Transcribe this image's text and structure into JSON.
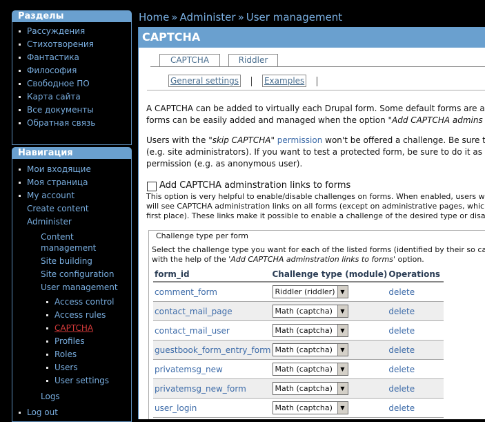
{
  "sidebar_sections": {
    "title": "Разделы",
    "items": [
      "Рассуждения",
      "Стихотворения",
      "Фантастика",
      "Философия",
      "Свободное ПО",
      "Карта сайта",
      "Все документы",
      "Обратная связь"
    ]
  },
  "sidebar_navigation": {
    "title": "Навигация",
    "items": [
      "Мои входящие",
      "Моя страница",
      "My account",
      "Create content",
      "Administer"
    ],
    "administer_items": [
      "Content management",
      "Site building",
      "Site configuration",
      "User management"
    ],
    "user_management_items": [
      "Access control",
      "Access rules",
      "CAPTCHA",
      "Profiles",
      "Roles",
      "Users",
      "User settings"
    ],
    "logs": "Logs",
    "logout": "Log out"
  },
  "breadcrumb": [
    "Home",
    "Administer",
    "User management"
  ],
  "page_title": "CAPTCHA",
  "tabs": [
    "CAPTCHA",
    "Riddler"
  ],
  "subtabs": [
    "General settings",
    "Examples"
  ],
  "intro": {
    "line1": "A CAPTCHA can be added to virtually each Drupal form. Some default forms are a",
    "line2_pre": "forms can be easily added and managed when the option \"",
    "line2_em": "Add CAPTCHA admins",
    "users_pre": "Users with the \"",
    "users_em": "skip CAPTCHA",
    "users_mid": "\" ",
    "users_link": "permission",
    "users_post": " won't be offered a challenge. Be sure t",
    "line4": "(e.g. site administrators). If you want to test a protected form, be sure to do it as",
    "line5": "permission (e.g. as anonymous user)."
  },
  "checkbox_label": "Add CAPTCHA adminstration links to forms",
  "checkbox_desc": [
    "This option is very helpful to enable/disable challenges on forms. When enabled, users with",
    "will see CAPTCHA administration links on all forms (except on administrative pages, which s",
    "first place). These links make it possible to enable a challenge of the desired type or disab"
  ],
  "fieldset": {
    "legend": "Challenge type per form",
    "desc1": "Select the challenge type you want for each of the listed forms (identified by their so ca",
    "desc2_pre": "with the help of the '",
    "desc2_em": "Add CAPTCHA adminstration links to forms",
    "desc2_post": "' option."
  },
  "table": {
    "headers": [
      "form_id",
      "Challenge type (module)",
      "Operations"
    ],
    "rows": [
      {
        "form_id": "comment_form",
        "type": "Riddler (riddler)",
        "op": "delete"
      },
      {
        "form_id": "contact_mail_page",
        "type": "Math (captcha)",
        "op": "delete"
      },
      {
        "form_id": "contact_mail_user",
        "type": "Math (captcha)",
        "op": "delete"
      },
      {
        "form_id": "guestbook_form_entry_form",
        "type": "Math (captcha)",
        "op": "delete"
      },
      {
        "form_id": "privatemsg_new",
        "type": "Math (captcha)",
        "op": "delete"
      },
      {
        "form_id": "privatemsg_new_form",
        "type": "Math (captcha)",
        "op": "delete"
      },
      {
        "form_id": "user_login",
        "type": "Math (captcha)",
        "op": "delete"
      }
    ]
  }
}
